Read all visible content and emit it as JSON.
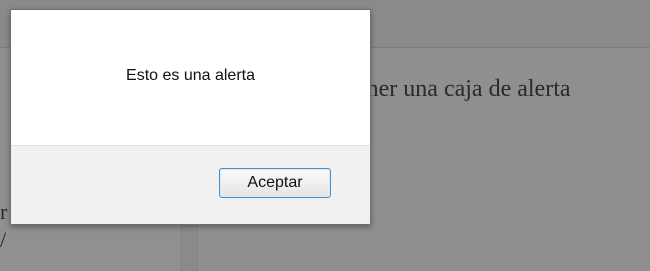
{
  "background_page": {
    "left_text": "r\n/",
    "content_text": "ener una caja de alerta"
  },
  "alert": {
    "message": "Esto es una alerta",
    "accept_label": "Aceptar"
  }
}
